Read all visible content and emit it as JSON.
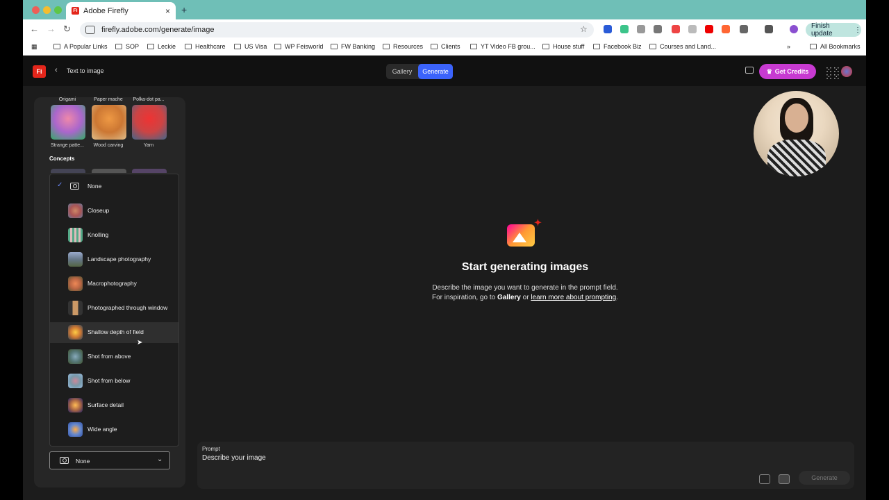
{
  "browser": {
    "tab_title": "Adobe Firefly",
    "tab_close": "×",
    "new_tab": "+",
    "url": "firefly.adobe.com/generate/image",
    "finish_update": "Finish update",
    "bookmarks": [
      "A Popular Links",
      "SOP",
      "Leckie",
      "Healthcare",
      "US Visa",
      "WP Feisworld",
      "FW Banking",
      "Resources",
      "Clients",
      "YT Video FB grou...",
      "House stuff",
      "Facebook Biz",
      "Courses and Land..."
    ],
    "all_bookmarks": "All Bookmarks",
    "more": "»"
  },
  "app": {
    "logo": "Fi",
    "back_label": "Text to image",
    "tabs": {
      "gallery": "Gallery",
      "generate": "Generate"
    },
    "get_credits": "Get Credits"
  },
  "styles": {
    "top_labels": [
      "Origami",
      "Paper mache",
      "Polka-dot pa..."
    ],
    "bottom_labels": [
      "Strange patte...",
      "Wood carving",
      "Yarn"
    ],
    "concepts": "Concepts"
  },
  "menu": {
    "selected": "None",
    "items": [
      "None",
      "Closeup",
      "Knolling",
      "Landscape photography",
      "Macrophotography",
      "Photographed through window",
      "Shallow depth of field",
      "Shot from above",
      "Shot from below",
      "Surface detail",
      "Wide angle"
    ],
    "highlighted_index": 6
  },
  "dropdown_value": "None",
  "center": {
    "title": "Start generating images",
    "line1": "Describe the image you want to generate in the prompt field.",
    "line2_prefix": "For inspiration, go to ",
    "line2_gallery": "Gallery",
    "line2_or": " or ",
    "line2_link": "learn more about prompting",
    "line2_end": "."
  },
  "prompt": {
    "label": "Prompt",
    "placeholder": "Describe your image",
    "generate": "Generate"
  },
  "colors": {
    "accent": "#3b63fb",
    "credits": "#c73ad1",
    "brand": "#e4261b"
  }
}
